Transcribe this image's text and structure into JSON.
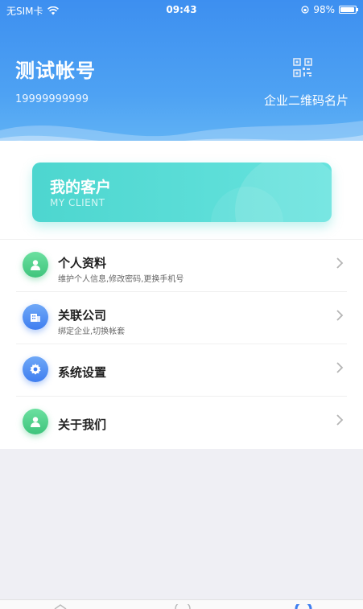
{
  "status_bar": {
    "carrier": "无SIM卡",
    "time": "09:43",
    "battery": "98%"
  },
  "profile": {
    "name": "测试帐号",
    "phone": "19999999999",
    "qr_label": "企业二维码名片"
  },
  "client_card": {
    "title": "我的客户",
    "subtitle": "MY CLIENT"
  },
  "menu": [
    {
      "title": "个人资料",
      "desc": "维护个人信息,修改密码,更换手机号",
      "icon": "person-icon"
    },
    {
      "title": "关联公司",
      "desc": "绑定企业,切换帐套",
      "icon": "company-icon"
    },
    {
      "title": "系统设置",
      "desc": "",
      "icon": "gear-icon"
    },
    {
      "title": "关于我们",
      "desc": "",
      "icon": "person-icon"
    }
  ],
  "colors": {
    "header_blue": "#3d8ff0",
    "card_teal": "#4dd6cf",
    "icon_green": "#3fc47c",
    "icon_blue": "#3f7ef0"
  }
}
